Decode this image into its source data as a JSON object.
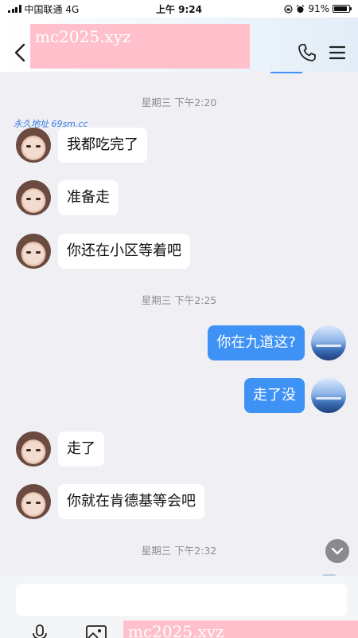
{
  "status_bar": {
    "carrier": "中国联通  4G",
    "time": "上午 9:24",
    "battery_percent": "91%",
    "battery_level": 0.91
  },
  "nav": {
    "back_icon": "chevron-left-icon",
    "call_icon": "phone-icon",
    "menu_icon": "hamburger-menu-icon"
  },
  "watermarks": {
    "top": "mc2025.xyz",
    "bottom": "mc2025.xyz",
    "link": "永久地址 69sm.cc"
  },
  "timestamps": [
    "星期三 下午2:20",
    "星期三 下午2:25",
    "星期三 下午2:32"
  ],
  "messages": [
    {
      "side": "left",
      "text": "我都吃完了"
    },
    {
      "side": "left",
      "text": "准备走"
    },
    {
      "side": "left",
      "text": "你还在小区等着吧"
    },
    {
      "side": "right",
      "text": "你在九道这?"
    },
    {
      "side": "right",
      "text": "走了没"
    },
    {
      "side": "left",
      "text": "走了"
    },
    {
      "side": "left",
      "text": "你就在肯德基等会吧"
    }
  ],
  "input": {
    "value": "",
    "placeholder": ""
  },
  "toolbar": {
    "voice_icon": "microphone-icon",
    "image_icon": "image-icon"
  },
  "colors": {
    "outgoing_bubble": "#3f92f5",
    "incoming_bubble": "#ffffff",
    "background": "#efeff4",
    "watermark": "#ffc0cb"
  }
}
